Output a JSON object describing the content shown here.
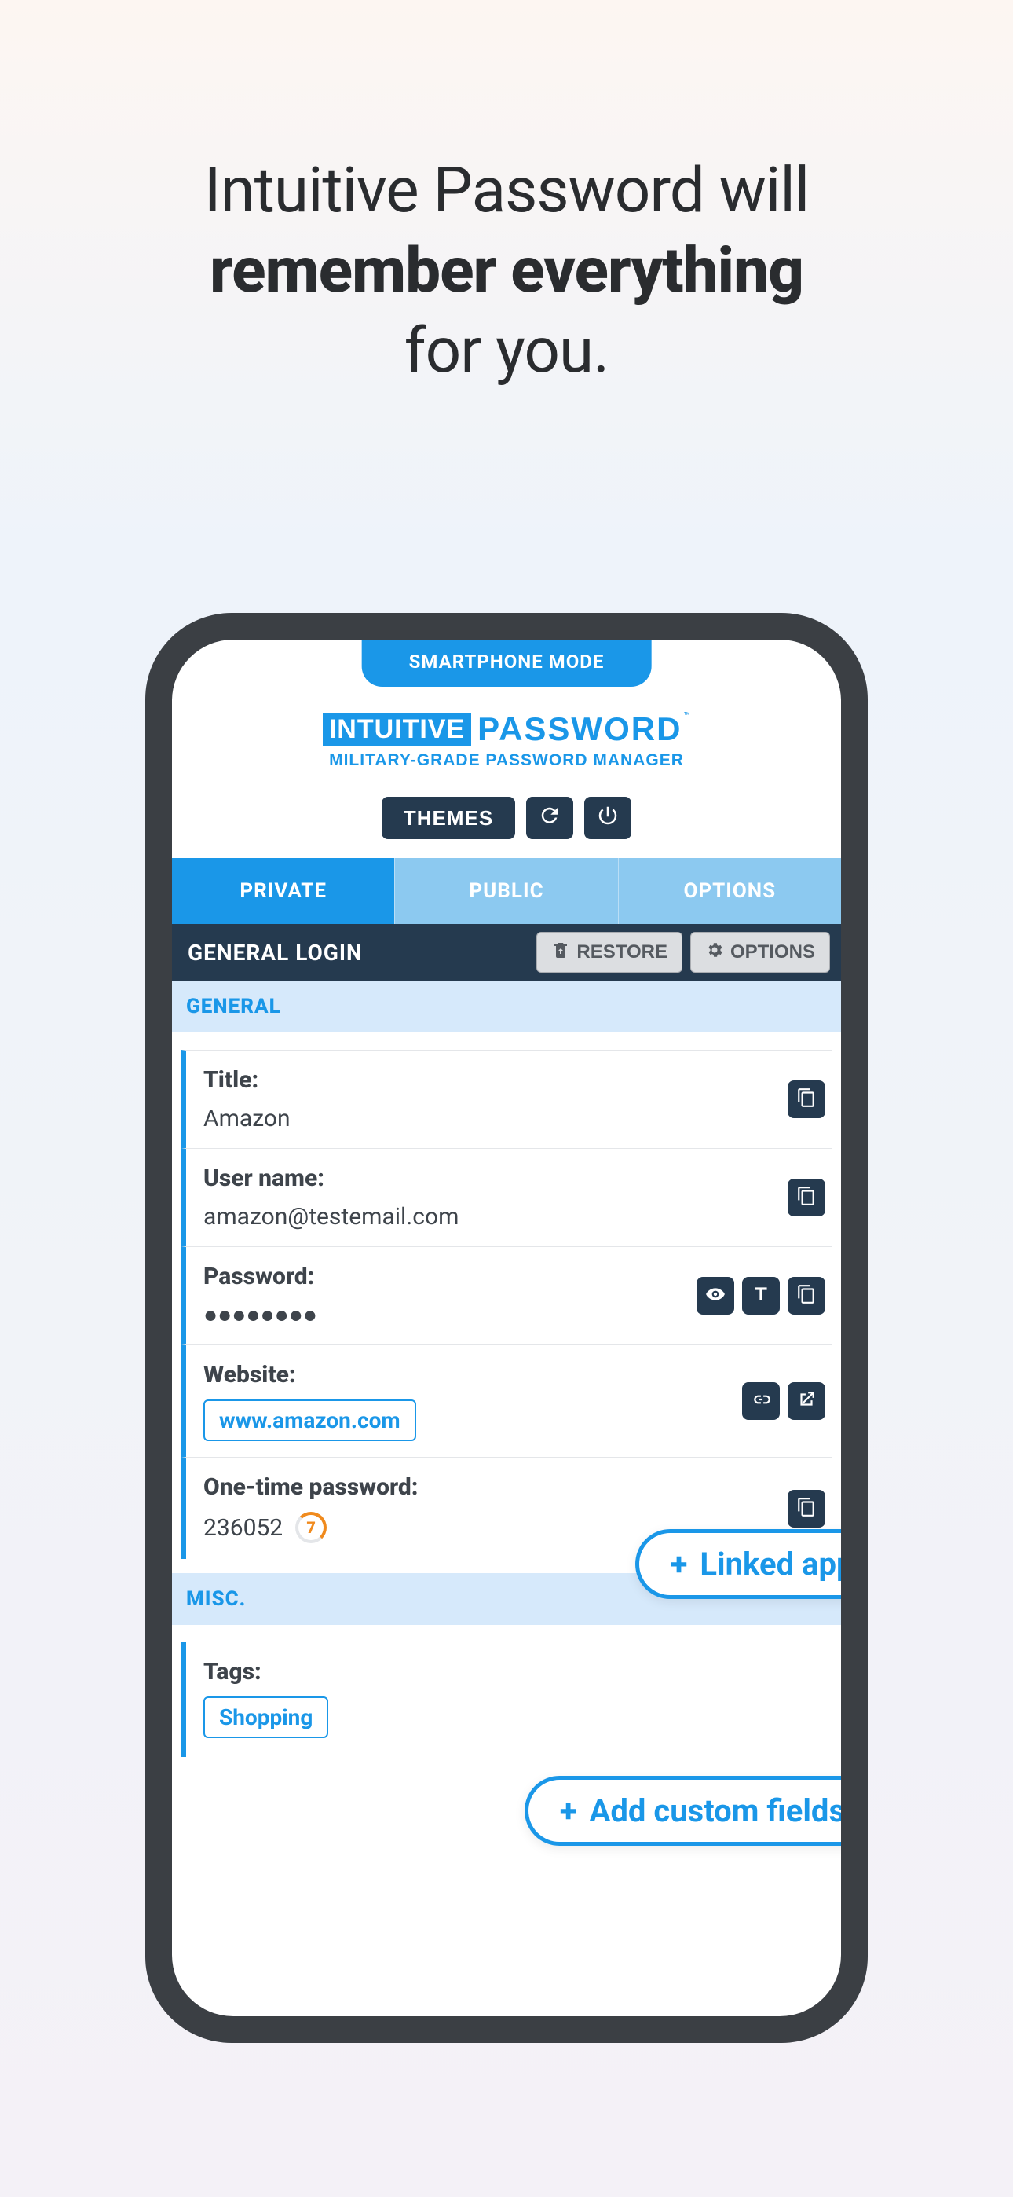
{
  "hero": {
    "line1": "Intuitive Password will",
    "line2": "remember everything",
    "line3": "for you."
  },
  "mode_label": "SMARTPHONE MODE",
  "logo": {
    "box": "INTUITIVE",
    "word": "PASSWORD",
    "tm": "™",
    "sub": "Military-Grade Password Manager"
  },
  "toolbar": {
    "themes": "THEMES"
  },
  "tabs": {
    "private": "PRIVATE",
    "public": "PUBLIC",
    "options": "OPTIONS"
  },
  "subheader": {
    "title": "GENERAL LOGIN",
    "restore": "RESTORE",
    "options": "OPTIONS"
  },
  "sections": {
    "general": "GENERAL",
    "misc": "MISC."
  },
  "fields": {
    "title": {
      "label": "Title:",
      "value": "Amazon"
    },
    "username": {
      "label": "User name:",
      "value": "amazon@testemail.com"
    },
    "password": {
      "label": "Password:",
      "value": "●●●●●●●●"
    },
    "website": {
      "label": "Website:",
      "value": "www.amazon.com"
    },
    "otp": {
      "label": "One-time password:",
      "value": "236052",
      "timer": "7"
    },
    "tags": {
      "label": "Tags:",
      "value": "Shopping"
    }
  },
  "callouts": {
    "linked": "Linked apps",
    "custom": "Add custom fields"
  }
}
